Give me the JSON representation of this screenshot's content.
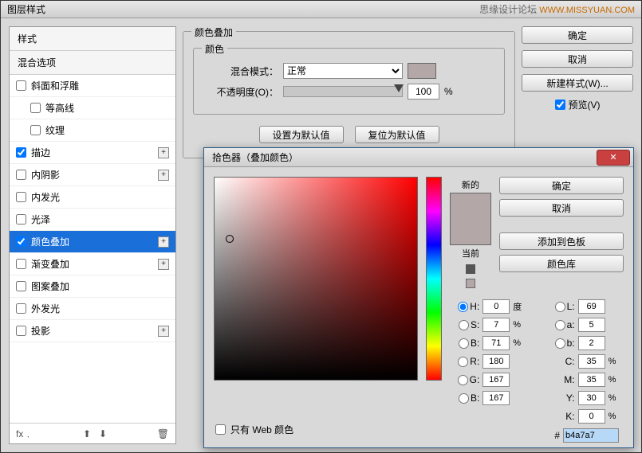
{
  "watermark": {
    "site": "思缘设计论坛",
    "url": "WWW.MISSYUAN.COM"
  },
  "layerStyle": {
    "title": "图层样式",
    "stylesHeader": "样式",
    "blendHeader": "混合选项",
    "items": [
      {
        "label": "斜面和浮雕",
        "checked": false,
        "plus": false
      },
      {
        "label": "等高线",
        "checked": false,
        "plus": false,
        "indent": true
      },
      {
        "label": "纹理",
        "checked": false,
        "plus": false,
        "indent": true
      },
      {
        "label": "描边",
        "checked": true,
        "plus": true
      },
      {
        "label": "内阴影",
        "checked": false,
        "plus": true
      },
      {
        "label": "内发光",
        "checked": false,
        "plus": false
      },
      {
        "label": "光泽",
        "checked": false,
        "plus": false
      },
      {
        "label": "颜色叠加",
        "checked": true,
        "plus": true,
        "selected": true
      },
      {
        "label": "渐变叠加",
        "checked": false,
        "plus": true
      },
      {
        "label": "图案叠加",
        "checked": false,
        "plus": false
      },
      {
        "label": "外发光",
        "checked": false,
        "plus": false
      },
      {
        "label": "投影",
        "checked": false,
        "plus": true
      }
    ],
    "footFx": "fx﹒",
    "panel": {
      "groupTitle": "颜色叠加",
      "colorGroup": "颜色",
      "blendModeLabel": "混合模式：",
      "blendModeValue": "正常",
      "opacityLabel": "不透明度(O)：",
      "opacityValue": "100",
      "pct": "%",
      "setDefault": "设置为默认值",
      "resetDefault": "复位为默认值"
    },
    "buttons": {
      "ok": "确定",
      "cancel": "取消",
      "newStyle": "新建样式(W)...",
      "preview": "预览(V)"
    }
  },
  "colorPicker": {
    "title": "拾色器（叠加颜色）",
    "newLabel": "新的",
    "curLabel": "当前",
    "ok": "确定",
    "cancel": "取消",
    "addSwatch": "添加到色板",
    "libs": "颜色库",
    "values": {
      "H": "0",
      "Hunit": "度",
      "S": "7",
      "B": "71",
      "R": "180",
      "G": "167",
      "Bb": "167",
      "L": "69",
      "a": "5",
      "b2": "2",
      "C": "35",
      "M": "35",
      "Y": "30",
      "K": "0",
      "pct": "%"
    },
    "labels": {
      "H": "H:",
      "S": "S:",
      "B": "B:",
      "L": "L:",
      "a": "a:",
      "b": "b:",
      "R": "R:",
      "G": "G:",
      "Bb": "B:",
      "C": "C:",
      "M": "M:",
      "Y": "Y:",
      "K": "K:"
    },
    "hexLabel": "#",
    "hex": "b4a7a7",
    "webOnly": "只有 Web 颜色"
  }
}
